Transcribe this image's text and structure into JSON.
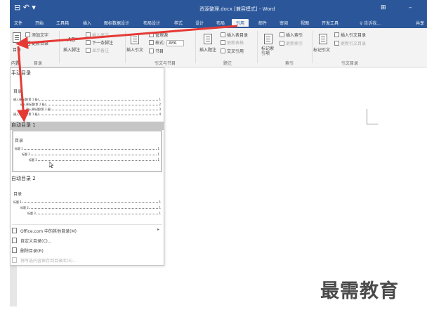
{
  "titlebar": {
    "qat": "⊟ ↶ ▾",
    "doc_title": "资源整理.docx [兼容模式] - Word",
    "restore_icon": "⊞",
    "minimize_icon": "–"
  },
  "tabs": [
    "文件",
    "开始",
    "工具箱",
    "插入",
    "图标数据设计",
    "布局设计",
    "样式",
    "设计",
    "布局",
    "引用",
    "邮件",
    "审阅",
    "视图",
    "开发工具"
  ],
  "tab_active_index": 9,
  "tell_me": "♀ 告诉我...",
  "share_label": "共享",
  "ribbon": {
    "toc_label": "目录",
    "add_text": "添加文字",
    "update_toc": "更新目录",
    "group_toc": "目录",
    "ab_label": "AB¹",
    "insert_footnote": "插入脚注",
    "insert_endnote": "插入尾注",
    "next_footnote": "下一条脚注",
    "show_notes": "显示备注",
    "insert_citation": "插入引文",
    "manage_sources": "管理源",
    "style_label": "样式:",
    "style_value": "APA",
    "bibliography": "书目",
    "group_citation": "引文与书目",
    "insert_caption": "插入题注",
    "insert_table_of_figures": "插入表目录",
    "update_table": "更新表格",
    "cross_reference": "交叉引用",
    "group_caption": "题注",
    "mark_entry": "标记索引项",
    "insert_index": "插入索引",
    "update_index": "更新索引",
    "group_index": "索引",
    "mark_citation": "标记引文",
    "insert_table_of_authorities": "插入引文目录",
    "update_authorities": "更新引文目录",
    "group_authorities": "引文目录",
    "content_label": "内置"
  },
  "gallery": {
    "manual_head": "手动目录",
    "manual_thumb": {
      "title": "目录",
      "lines": [
        {
          "label": "键入章标题(第 1 级)",
          "num": "1"
        },
        {
          "label": "键入章标题(第 2 级)",
          "num": "2"
        },
        {
          "label": "键入章标题(第 3 级)",
          "num": "3"
        },
        {
          "label": "键入章标题(第 1 级)",
          "num": "4"
        }
      ]
    },
    "auto1_head": "自动目录 1",
    "auto1_thumb": {
      "title": "目录",
      "lines": [
        {
          "label": "标题 1",
          "num": "1"
        },
        {
          "label": "标题 2",
          "num": "1"
        },
        {
          "label": "标题 3",
          "num": "1"
        }
      ]
    },
    "auto2_head": "自动目录 2",
    "auto2_thumb": {
      "title": "目录",
      "lines": [
        {
          "label": "标题 1",
          "num": "1"
        },
        {
          "label": "标题 2",
          "num": "1"
        },
        {
          "label": "标题 3",
          "num": "1"
        }
      ]
    },
    "menu": [
      {
        "label": "Office.com 中的其他目录(M)",
        "arrow": "▸"
      },
      {
        "label": "自定义目录(C)..."
      },
      {
        "label": "删除目录(R)"
      },
      {
        "label": "将所选内容保存到目录库(S)..."
      }
    ]
  },
  "watermark": "最需教育",
  "colors": {
    "titlebar": "#2b579a",
    "ribbon_bg": "#f3f3f3",
    "selection_gray": "#c6c6c6",
    "arrow_red": "#e53935"
  }
}
